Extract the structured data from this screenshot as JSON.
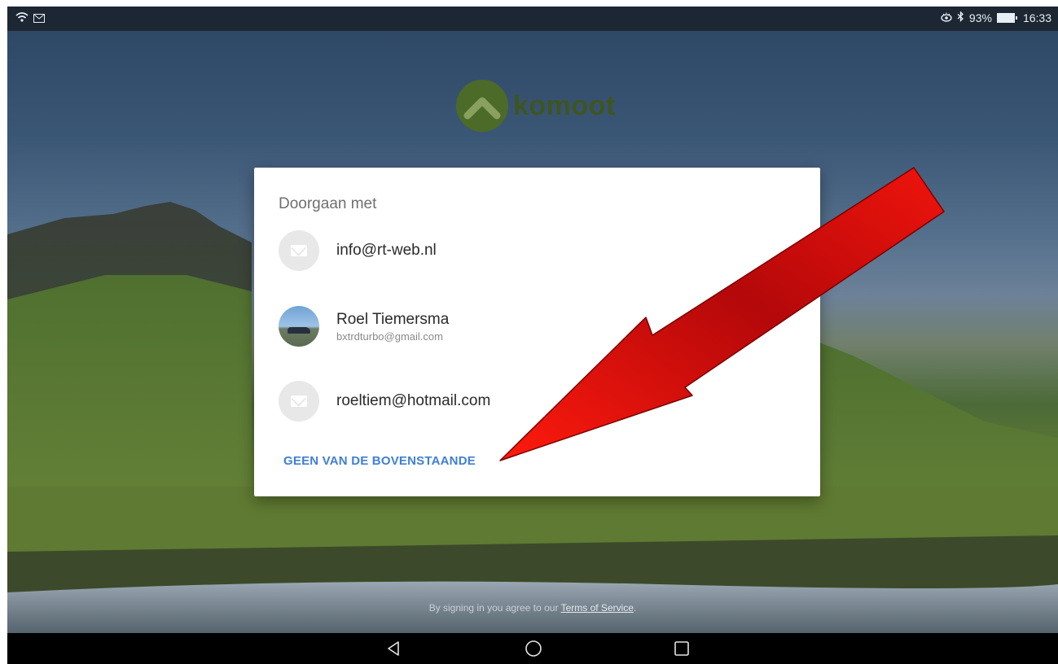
{
  "status_bar": {
    "left_icons": [
      "wifi-icon",
      "mail-icon"
    ],
    "battery_percent": "93%",
    "time": "16:33",
    "right_icons": [
      "eye-comfort-icon",
      "bluetooth-icon",
      "battery-icon"
    ]
  },
  "app": {
    "logo_text": "komoot"
  },
  "dialog": {
    "title": "Doorgaan met",
    "accounts": [
      {
        "email": "info@rt-web.nl",
        "avatar": "mail-icon"
      },
      {
        "name": "Roel Tiemersma",
        "email": "bxtrdturbo@gmail.com",
        "avatar": "profile-photo"
      },
      {
        "email": "roeltiem@hotmail.com",
        "avatar": "mail-icon"
      }
    ],
    "none_button": "GEEN VAN DE BOVENSTAANDE"
  },
  "footer": {
    "terms_prefix": "By signing in you agree to our ",
    "terms_link": "Terms of Service",
    "terms_suffix": "."
  },
  "nav": [
    "back-icon",
    "home-icon",
    "recents-icon"
  ],
  "colors": {
    "accent_link": "#3f7fd6",
    "annotation_arrow": "#d9140c",
    "brand_green": "#4c6a28"
  }
}
